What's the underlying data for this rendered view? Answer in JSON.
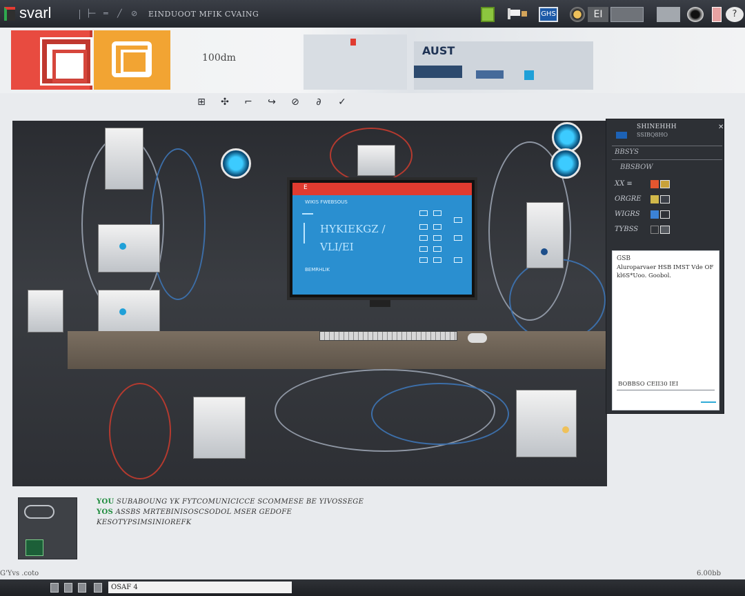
{
  "window": {
    "app_name": "svarl",
    "title": "EINDUOOT MFIK CVAING",
    "title_glyphs": [
      "├─",
      "═",
      "╱",
      "⊘"
    ],
    "toolbar_badge": "GHS",
    "gadget_label": "EI",
    "option_label": "?",
    "progress_fraction": 0.3
  },
  "toolbar": {
    "zoom_label": "100dm",
    "art_text": "AUST",
    "mini_tools": [
      "⊞",
      "✣",
      "⌐",
      "↪",
      "⊘",
      "∂",
      "✓"
    ]
  },
  "canvas": {
    "monitor_bar_label": "E",
    "monitor_heading": "WIKIS FWEBSOUS",
    "monitor_big_text": "HYKIEKGZ / VLI/EI",
    "monitor_footer": "BEMRHLIK"
  },
  "side_panel": {
    "title": "SHINEHHH",
    "subtitle": "SSIBQ8HO",
    "close_label": "✕",
    "section_1": "BBSYS",
    "section_2": "BBSBOW",
    "rows": [
      {
        "label": "XX ≡",
        "color": "#e3562f"
      },
      {
        "label": "ORGRE",
        "color": "#d1b84a"
      },
      {
        "label": "WIGRS",
        "color": "#3b82d6"
      },
      {
        "label": "TYBSS",
        "color": "#2f3237"
      }
    ],
    "card": {
      "title": "GSB",
      "body": "Aluroparvaer HSB IMST Vde OF kl6S*Uoo. Goobol.",
      "input_value": "BOBBSO  CEII30  IEI"
    }
  },
  "info": {
    "line_1_prefix": "YOU",
    "line_1": "SUBABOUNG YK  FYTCOMUNICICCE  SCOMMESE BE  YIVOSSEGE",
    "line_2_prefix": "YOS",
    "line_2": "ASSBS  MRTEBINISOSCSODOL  MSER  GEDOFE",
    "line_3": "KESOTYPSIMSINIOREFK"
  },
  "status": {
    "left_label": "G'Yvs  .coto",
    "field_value": "OSAF  4",
    "right_label": "6.00bb"
  },
  "colors": {
    "accent_red": "#e84b40",
    "accent_orange": "#f2a433",
    "screen_blue": "#2a8fd0",
    "dark_panel": "#2d3035"
  }
}
